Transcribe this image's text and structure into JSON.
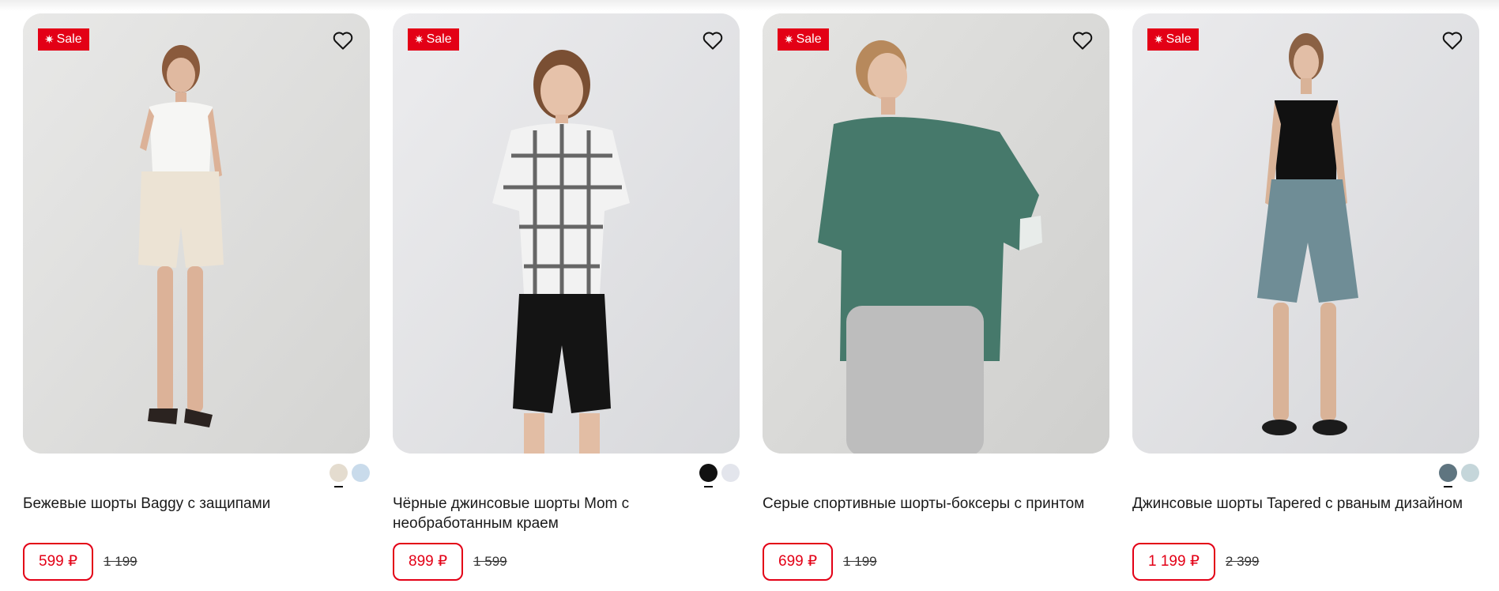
{
  "products": [
    {
      "badge": "Sale",
      "title": "Бежевые шорты Baggy с защипами",
      "price": "599 ₽",
      "old_price": "1 199",
      "image_bg": "#e2e2e0",
      "swatches": [
        {
          "color": "#e4dccf",
          "active": true
        },
        {
          "color": "#c9dbeb",
          "active": false
        }
      ]
    },
    {
      "badge": "Sale",
      "title": "Чёрные джинсовые шорты Mom с необработанным краем",
      "price": "899 ₽",
      "old_price": "1 599",
      "image_bg": "#e4e5e8",
      "swatches": [
        {
          "color": "#111111",
          "active": true
        },
        {
          "color": "#e3e5ec",
          "active": false
        }
      ]
    },
    {
      "badge": "Sale",
      "title": "Серые спортивные шорты-боксеры с принтом",
      "price": "699 ₽",
      "old_price": "1 199",
      "image_bg": "#dcdcda",
      "swatches": []
    },
    {
      "badge": "Sale",
      "title": "Джинсовые шорты Tapered с рваным дизайном",
      "price": "1 199 ₽",
      "old_price": "2 399",
      "image_bg": "#e4e5e7",
      "swatches": [
        {
          "color": "#5f7580",
          "active": true
        },
        {
          "color": "#c5d6da",
          "active": false
        }
      ]
    }
  ],
  "icons": {
    "sale": "asterisk-icon",
    "wishlist": "heart-icon"
  },
  "colors": {
    "accent": "#e30016"
  }
}
